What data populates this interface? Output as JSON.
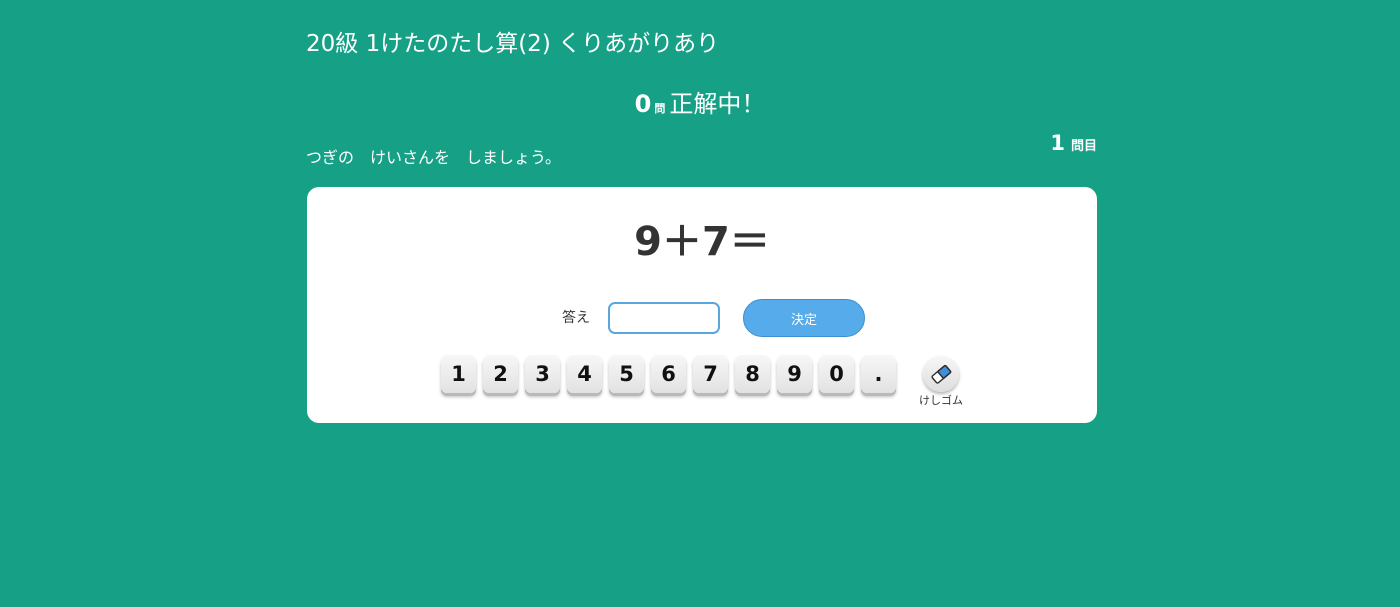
{
  "header": {
    "level_title": "20級 1けたのたし算(2) くりあがりあり"
  },
  "score": {
    "count": "0",
    "unit": "問",
    "label": "正解中！"
  },
  "instruction": "つぎの　けいさんを　しましょう。",
  "question_number": {
    "value": "1",
    "unit": "問目"
  },
  "problem": {
    "expression": "9＋7＝"
  },
  "answer": {
    "label": "答え",
    "value": "",
    "placeholder": ""
  },
  "submit": {
    "label": "決定"
  },
  "keypad": {
    "keys": [
      "1",
      "2",
      "3",
      "4",
      "5",
      "6",
      "7",
      "8",
      "9",
      "0",
      "."
    ]
  },
  "eraser": {
    "label": "けしゴム",
    "icon": "eraser-icon"
  },
  "colors": {
    "background": "#16a086",
    "card": "#ffffff",
    "button": "#56abea",
    "input_border": "#5aa7e0"
  }
}
